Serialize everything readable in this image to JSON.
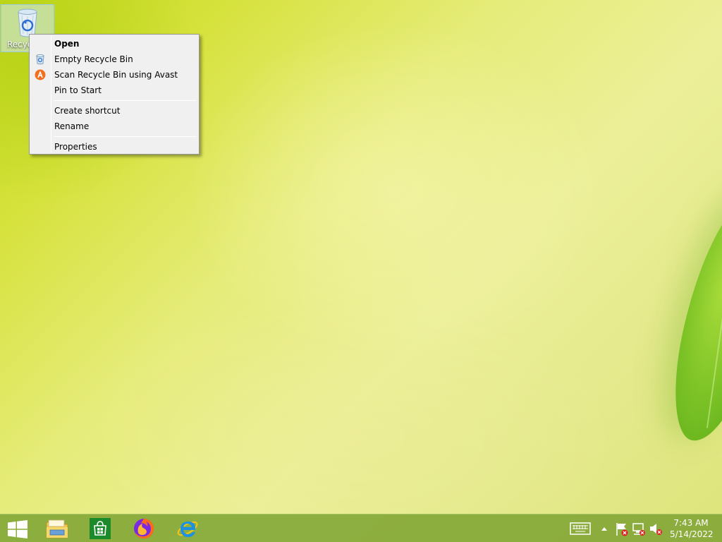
{
  "desktop": {
    "recycle_bin_label": "Recyc"
  },
  "context_menu": {
    "items": [
      {
        "label": "Open",
        "bold": true
      },
      {
        "label": "Empty Recycle Bin",
        "icon": "recycle-bin-icon"
      },
      {
        "label": "Scan Recycle Bin using Avast",
        "icon": "avast-icon"
      },
      {
        "label": "Pin to Start"
      },
      {
        "label": "Create shortcut"
      },
      {
        "label": "Rename"
      },
      {
        "label": "Properties"
      }
    ]
  },
  "taskbar": {
    "start_icon": "windows-logo-icon",
    "pinned_apps": [
      {
        "name": "File Explorer",
        "icon": "file-explorer-icon"
      },
      {
        "name": "Store",
        "icon": "store-icon"
      },
      {
        "name": "Firefox",
        "icon": "firefox-icon"
      },
      {
        "name": "Internet Explorer",
        "icon": "internet-explorer-icon"
      }
    ],
    "tray": {
      "icons": [
        "touch-keyboard-icon",
        "show-hidden-icons-chevron",
        "action-center-flag-icon",
        "network-icon",
        "volume-muted-icon"
      ]
    },
    "clock": {
      "time": "7:43 AM",
      "date": "5/14/2022"
    }
  },
  "colors": {
    "taskbar": "#84a838",
    "menu_bg": "#f0f0f0",
    "avast_orange": "#f07020",
    "store_green": "#1a8a2a",
    "ie_blue": "#1e90e0"
  }
}
